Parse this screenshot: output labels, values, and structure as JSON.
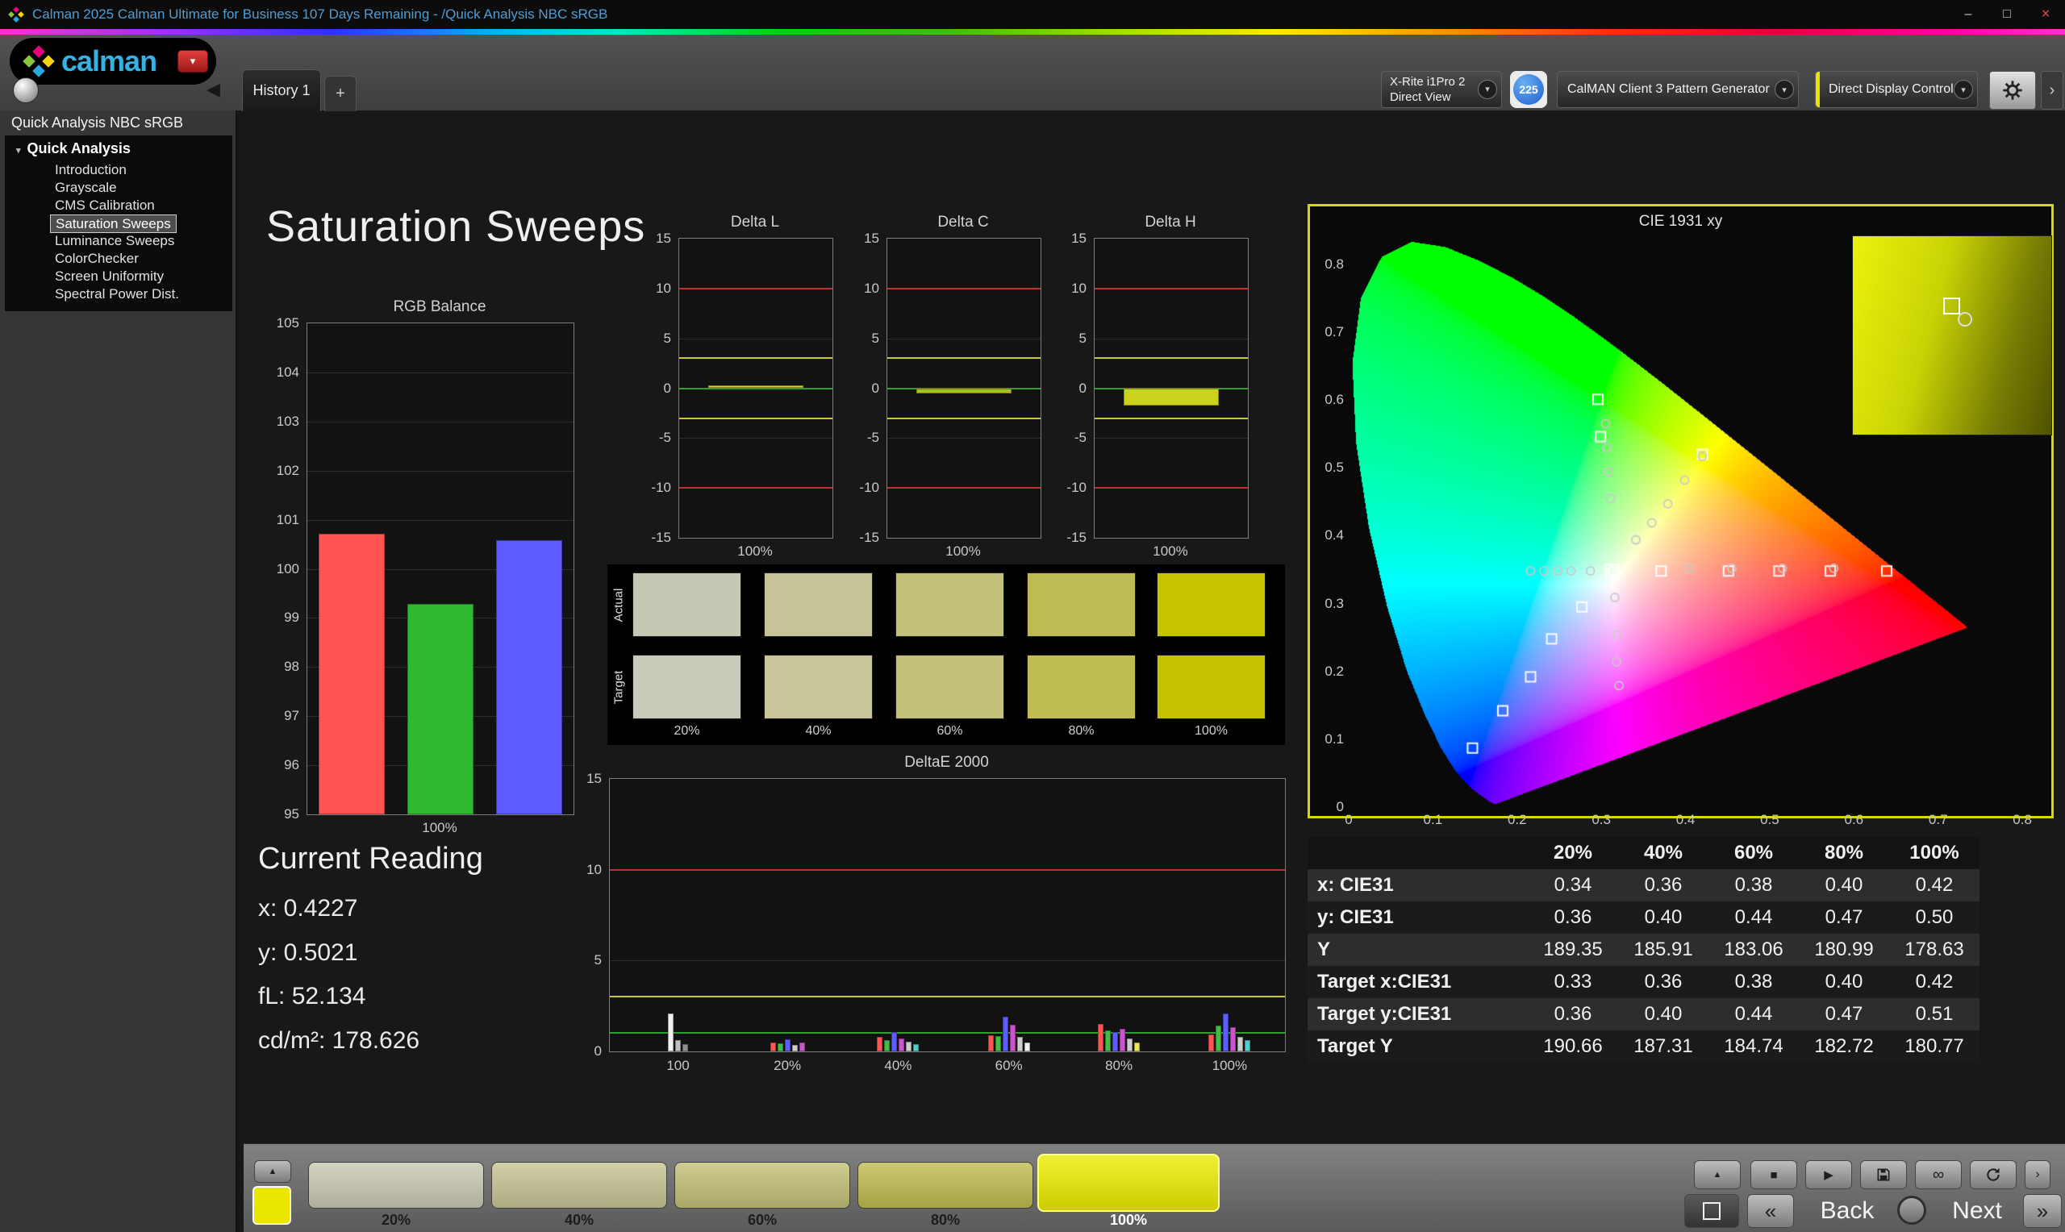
{
  "window": {
    "title": "Calman 2025 Calman Ultimate for Business 107 Days Remaining  - /Quick Analysis NBC sRGB",
    "controls": {
      "minimize": "–",
      "maximize": "□",
      "close": "×"
    }
  },
  "logo": {
    "brand": "calman"
  },
  "icons": {
    "dropdown": "▾",
    "collapse_left": "◀",
    "panel_chevron": "›",
    "plus": "+",
    "tree_expanded": "▾",
    "up_chevron": "▲",
    "stop": "■",
    "play": "▶",
    "infinity": "∞",
    "back_chevrons": "«",
    "next_chevrons": "»",
    "forward_chevron": "›"
  },
  "tab_bar": {
    "tabs": [
      {
        "label": "History 1",
        "active": true
      }
    ]
  },
  "toolbar": {
    "meter_dropdown": {
      "line1": "X-Rite i1Pro 2",
      "line2": "Direct View"
    },
    "badge_count": "225",
    "pattern_dropdown": "CalMAN Client 3 Pattern Generator",
    "display_dropdown": "Direct Display Control"
  },
  "sidebar": {
    "workflow_title": "Quick Analysis NBC sRGB",
    "tree_root": "Quick Analysis",
    "items": [
      "Introduction",
      "Grayscale",
      "CMS Calibration",
      "Saturation Sweeps",
      "Luminance Sweeps",
      "ColorChecker",
      "Screen Uniformity",
      "Spectral Power Dist."
    ],
    "selected_item": "Saturation Sweeps"
  },
  "page": {
    "title": "Saturation Sweeps"
  },
  "current_reading": {
    "heading": "Current Reading",
    "x": "x: 0.4227",
    "y": "y: 0.5021",
    "fl": "fL: 52.134",
    "cd": "cd/m²: 178.626"
  },
  "swatch_grid": {
    "row_labels": [
      "Actual",
      "Target"
    ],
    "col_labels": [
      "20%",
      "40%",
      "60%",
      "80%",
      "100%"
    ],
    "actual_colors": [
      "#c7c7b6",
      "#c6c398",
      "#c2c07a",
      "#bdbb55",
      "#c6c400"
    ],
    "target_colors": [
      "#cacaba",
      "#c8c59b",
      "#c4c17c",
      "#bfbc53",
      "#c3c100"
    ]
  },
  "table": {
    "headers": [
      "",
      "20%",
      "40%",
      "60%",
      "80%",
      "100%"
    ],
    "rows": [
      {
        "label": "x: CIE31",
        "values": [
          "0.34",
          "0.36",
          "0.38",
          "0.40",
          "0.42"
        ]
      },
      {
        "label": "y: CIE31",
        "values": [
          "0.36",
          "0.40",
          "0.44",
          "0.47",
          "0.50"
        ]
      },
      {
        "label": "Y",
        "values": [
          "189.35",
          "185.91",
          "183.06",
          "180.99",
          "178.63"
        ]
      },
      {
        "label": "Target x:CIE31",
        "values": [
          "0.33",
          "0.36",
          "0.38",
          "0.40",
          "0.42"
        ]
      },
      {
        "label": "Target y:CIE31",
        "values": [
          "0.36",
          "0.40",
          "0.44",
          "0.47",
          "0.51"
        ]
      },
      {
        "label": "Target Y",
        "values": [
          "190.66",
          "187.31",
          "184.74",
          "182.72",
          "180.77"
        ]
      }
    ]
  },
  "bottom_bar": {
    "swatches": [
      {
        "label": "20%",
        "color": "#c9c9b2",
        "selected": false
      },
      {
        "label": "40%",
        "color": "#c7c494",
        "selected": false
      },
      {
        "label": "60%",
        "color": "#c3c076",
        "selected": false
      },
      {
        "label": "80%",
        "color": "#bfbc50",
        "selected": false
      },
      {
        "label": "100%",
        "color": "#ecec00",
        "selected": true
      }
    ],
    "back_label": "Back",
    "next_label": "Next"
  },
  "chart_data": [
    {
      "id": "rgb_balance",
      "type": "bar",
      "title": "RGB Balance",
      "ylim": [
        95,
        105
      ],
      "yticks": [
        105,
        104,
        103,
        102,
        101,
        100,
        99,
        98,
        97,
        96,
        95
      ],
      "gridlines": [
        104,
        103,
        102,
        101,
        100,
        99,
        98,
        97,
        96
      ],
      "baseline": 95,
      "bar_frac": 0.75,
      "categories": [
        "Red",
        "Green",
        "Blue"
      ],
      "values": [
        100.72,
        99.28,
        100.58
      ],
      "colors": [
        "#ff5454",
        "#2eb92e",
        "#5b5bff"
      ],
      "xlabel": "100%"
    },
    {
      "id": "delta_l",
      "type": "bar",
      "title": "Delta L",
      "ylim": [
        -15,
        15
      ],
      "yticks": [
        15,
        10,
        5,
        0,
        -5,
        -10,
        -15
      ],
      "gridlines": [
        5,
        -5
      ],
      "baseline": 0,
      "bar_frac": 0.62,
      "ref_lines": [
        {
          "v": 10,
          "color": "#c03030"
        },
        {
          "v": -10,
          "color": "#c03030"
        },
        {
          "v": 3,
          "color": "#c8c832"
        },
        {
          "v": -3,
          "color": "#c8c832"
        },
        {
          "v": 0,
          "color": "#2f9f2f"
        }
      ],
      "categories": [
        "100%"
      ],
      "values": [
        0.3
      ],
      "colors": [
        "#d6d61e"
      ],
      "xlabel": "100%"
    },
    {
      "id": "delta_c",
      "type": "bar",
      "title": "Delta C",
      "ylim": [
        -15,
        15
      ],
      "yticks": [
        15,
        10,
        5,
        0,
        -5,
        -10,
        -15
      ],
      "gridlines": [
        5,
        -5
      ],
      "baseline": 0,
      "bar_frac": 0.62,
      "ref_lines": [
        {
          "v": 10,
          "color": "#c03030"
        },
        {
          "v": -10,
          "color": "#c03030"
        },
        {
          "v": 3,
          "color": "#c8c832"
        },
        {
          "v": -3,
          "color": "#c8c832"
        },
        {
          "v": 0,
          "color": "#2f9f2f"
        }
      ],
      "categories": [
        "100%"
      ],
      "values": [
        -0.5
      ],
      "colors": [
        "#aebe1e"
      ],
      "xlabel": "100%"
    },
    {
      "id": "delta_h",
      "type": "bar",
      "title": "Delta H",
      "ylim": [
        -15,
        15
      ],
      "yticks": [
        15,
        10,
        5,
        0,
        -5,
        -10,
        -15
      ],
      "gridlines": [
        5,
        -5
      ],
      "baseline": 0,
      "bar_frac": 0.62,
      "ref_lines": [
        {
          "v": 10,
          "color": "#c03030"
        },
        {
          "v": -10,
          "color": "#c03030"
        },
        {
          "v": 3,
          "color": "#c8c832"
        },
        {
          "v": -3,
          "color": "#c8c832"
        },
        {
          "v": 0,
          "color": "#2f9f2f"
        }
      ],
      "categories": [
        "100%"
      ],
      "values": [
        -1.7
      ],
      "colors": [
        "#ccd21e"
      ],
      "xlabel": "100%"
    },
    {
      "id": "deltae_2000",
      "type": "grouped-bar",
      "title": "DeltaE 2000",
      "ylim": [
        0,
        15
      ],
      "yticks": [
        15,
        10,
        5,
        0
      ],
      "gridlines": [
        5
      ],
      "baseline": 0,
      "ref_lines": [
        {
          "v": 10,
          "color": "#c03030"
        },
        {
          "v": 3,
          "color": "#c8c832"
        },
        {
          "v": 1,
          "color": "#2f9f2f"
        }
      ],
      "categories": [
        "100",
        "20%",
        "40%",
        "60%",
        "80%",
        "100%"
      ],
      "group_x": [
        0.101,
        0.263,
        0.427,
        0.591,
        0.754,
        0.918
      ],
      "groups": [
        [
          [
            "#f0f0f0",
            2.1
          ],
          [
            "#c0c0c0",
            0.6
          ],
          [
            "#909090",
            0.4
          ]
        ],
        [
          [
            "#ff5555",
            0.5
          ],
          [
            "#44bb44",
            0.45
          ],
          [
            "#5c5cff",
            0.65
          ],
          [
            "#cccccc",
            0.35
          ],
          [
            "#cc55cc",
            0.5
          ]
        ],
        [
          [
            "#ff5555",
            0.8
          ],
          [
            "#44bb44",
            0.6
          ],
          [
            "#5c5cff",
            1.05
          ],
          [
            "#cc55cc",
            0.7
          ],
          [
            "#cccccc",
            0.55
          ],
          [
            "#55cccc",
            0.4
          ]
        ],
        [
          [
            "#ff5555",
            0.9
          ],
          [
            "#44bb44",
            0.85
          ],
          [
            "#5c5cff",
            1.9
          ],
          [
            "#cc55cc",
            1.45
          ],
          [
            "#cccccc",
            0.8
          ],
          [
            "#f0f0f0",
            0.5
          ]
        ],
        [
          [
            "#ff5555",
            1.5
          ],
          [
            "#44bb44",
            1.15
          ],
          [
            "#5c5cff",
            1.05
          ],
          [
            "#cc55cc",
            1.25
          ],
          [
            "#cccccc",
            0.7
          ],
          [
            "#e8e855",
            0.5
          ]
        ],
        [
          [
            "#ff5555",
            0.95
          ],
          [
            "#44bb44",
            1.4
          ],
          [
            "#5c5cff",
            2.1
          ],
          [
            "#cc55cc",
            1.35
          ],
          [
            "#cccccc",
            0.8
          ],
          [
            "#55cccc",
            0.6
          ]
        ]
      ]
    },
    {
      "id": "cie_1931",
      "type": "cie",
      "title": "CIE 1931 xy",
      "xmax": 0.82,
      "ymax": 0.87,
      "xticks": [
        "0",
        "0.1",
        "0.2",
        "0.3",
        "0.4",
        "0.5",
        "0.6",
        "0.7",
        "0.8"
      ],
      "yticks": [
        "0",
        "0.1",
        "0.2",
        "0.3",
        "0.4",
        "0.5",
        "0.6",
        "0.7",
        "0.8"
      ],
      "white_point": [
        0.313,
        0.348
      ],
      "targets": [
        [
          0.371,
          0.348
        ],
        [
          0.451,
          0.348
        ],
        [
          0.511,
          0.348
        ],
        [
          0.572,
          0.348
        ],
        [
          0.639,
          0.348
        ],
        [
          0.296,
          0.601
        ],
        [
          0.299,
          0.546
        ],
        [
          0.277,
          0.295
        ],
        [
          0.241,
          0.248
        ],
        [
          0.216,
          0.192
        ],
        [
          0.183,
          0.142
        ],
        [
          0.147,
          0.087
        ],
        [
          0.42,
          0.52
        ]
      ],
      "measurements": [
        [
          0.216,
          0.348
        ],
        [
          0.232,
          0.348
        ],
        [
          0.248,
          0.348
        ],
        [
          0.264,
          0.348
        ],
        [
          0.287,
          0.348
        ],
        [
          0.341,
          0.394
        ],
        [
          0.36,
          0.419
        ],
        [
          0.379,
          0.447
        ],
        [
          0.399,
          0.482
        ],
        [
          0.42,
          0.517
        ],
        [
          0.305,
          0.565
        ],
        [
          0.307,
          0.53
        ],
        [
          0.309,
          0.494
        ],
        [
          0.311,
          0.455
        ],
        [
          0.316,
          0.309
        ],
        [
          0.319,
          0.254
        ],
        [
          0.318,
          0.214
        ],
        [
          0.321,
          0.179
        ],
        [
          0.405,
          0.352
        ],
        [
          0.455,
          0.352
        ],
        [
          0.515,
          0.352
        ],
        [
          0.576,
          0.352
        ]
      ]
    }
  ]
}
